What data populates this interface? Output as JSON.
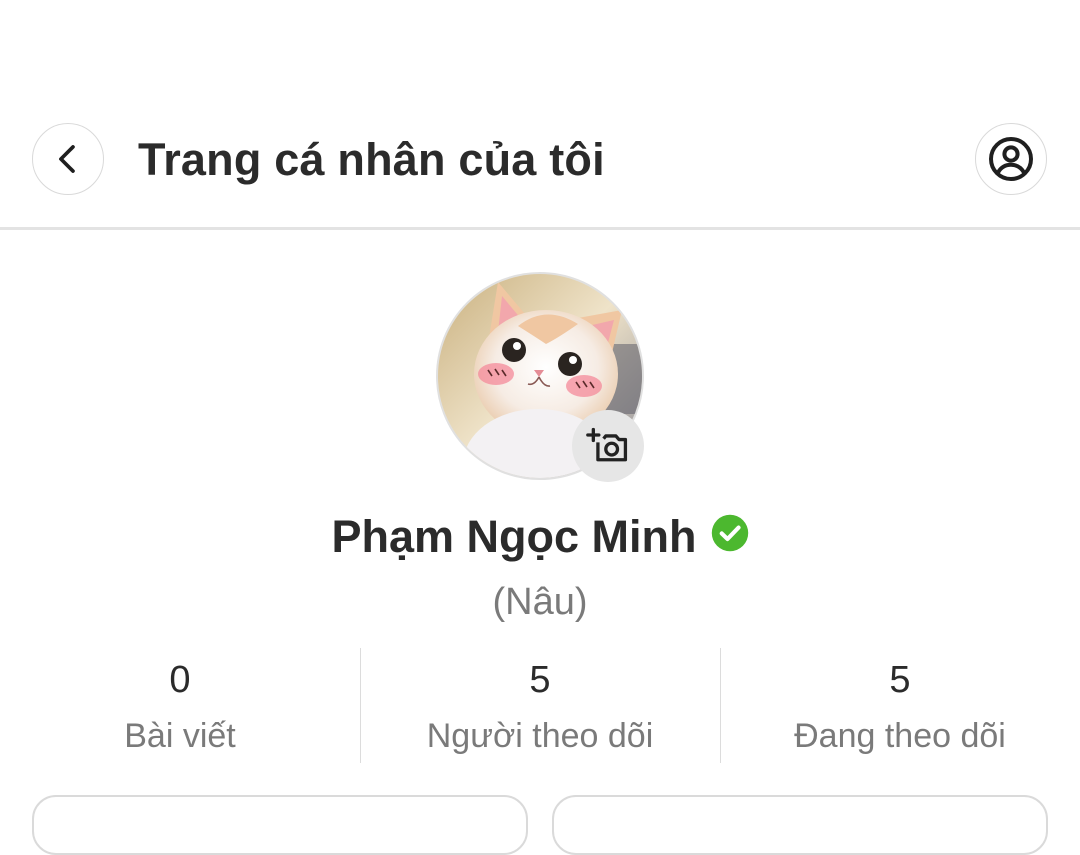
{
  "header": {
    "title": "Trang cá nhân của tôi",
    "back_icon": "chevron-left-icon",
    "profile_icon": "user-circle-icon"
  },
  "profile": {
    "name": "Phạm Ngọc Minh",
    "nickname": "(Nâu)",
    "verified": true,
    "verified_color": "#4cb82f",
    "avatar_description": "cat-photo",
    "camera_icon": "add-photo-camera-icon"
  },
  "stats": [
    {
      "value": "0",
      "label": "Bài viết"
    },
    {
      "value": "5",
      "label": "Người theo dõi"
    },
    {
      "value": "5",
      "label": "Đang theo dõi"
    }
  ],
  "colors": {
    "text_primary": "#2b2b2b",
    "text_secondary": "#7a7a7a",
    "divider": "#e3e3e3"
  }
}
